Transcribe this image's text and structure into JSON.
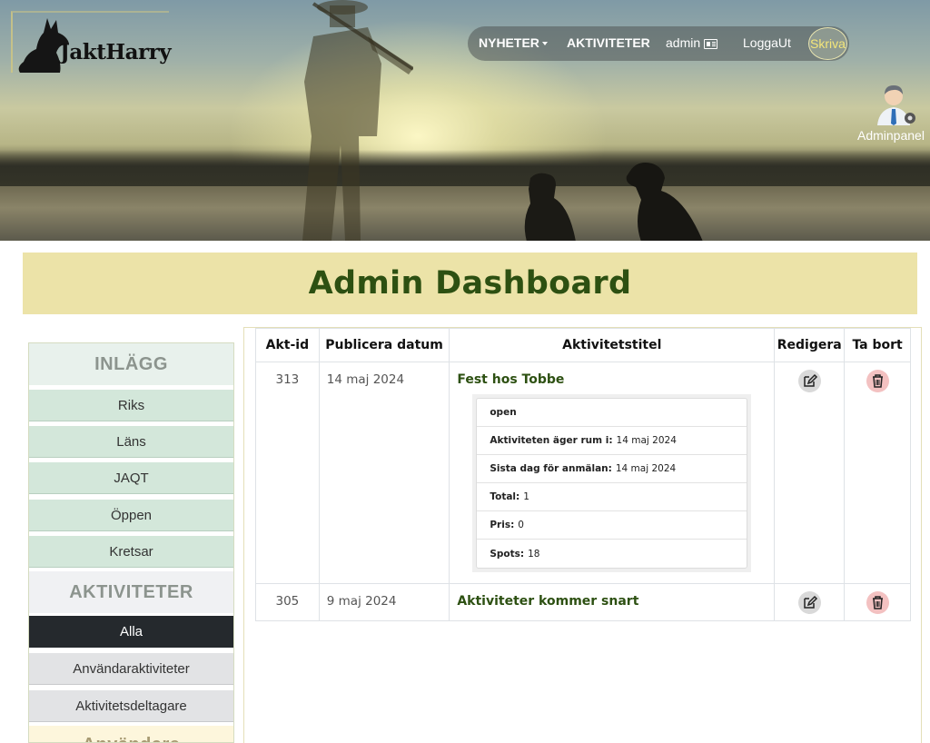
{
  "header": {
    "logo_text": "JaktHarry",
    "nav": {
      "news_label": "NYHETER",
      "activities_label": "AKTIVITETER",
      "user_label": "admin",
      "logout_label": "LoggaUt",
      "write_label": "Skriva"
    },
    "adminpanel_label": "Adminpanel"
  },
  "page_title": "Admin Dashboard",
  "sidebar": {
    "posts_heading": "INLÄGG",
    "posts_items": [
      "Riks",
      "Läns",
      "JAQT",
      "Öppen",
      "Kretsar"
    ],
    "activities_heading": "AKTIVITETER",
    "activities_items": [
      "Alla",
      "Användaraktiviteter",
      "Aktivitetsdeltagare"
    ],
    "next_heading": "Användare"
  },
  "table": {
    "headers": [
      "Akt-id",
      "Publicera datum",
      "Aktivitetstitel",
      "Redigera",
      "Ta bort"
    ],
    "rows": [
      {
        "id": "313",
        "date": "14 maj 2024",
        "title": "Fest hos Tobbe",
        "details": {
          "status": "open",
          "occurs_label": "Aktiviteten äger rum i:",
          "occurs_value": "14 maj 2024",
          "deadline_label": "Sista dag för anmälan:",
          "deadline_value": "14 maj 2024",
          "total_label": "Total:",
          "total_value": "1",
          "price_label": "Pris:",
          "price_value": "0",
          "spots_label": "Spots:",
          "spots_value": "18"
        }
      },
      {
        "id": "305",
        "date": "9 maj 2024",
        "title": "Aktiviteter kommer snart"
      }
    ]
  },
  "colors": {
    "title_green": "#2d5012",
    "title_band": "#ece3a8",
    "sidebar_green": "#d3e7da",
    "sidebar_dark": "#25292d"
  }
}
